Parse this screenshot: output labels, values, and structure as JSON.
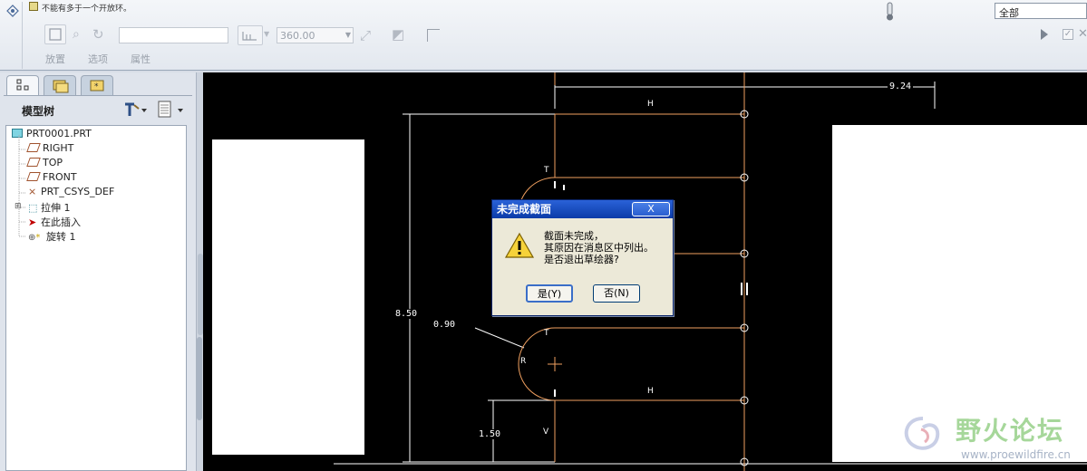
{
  "toolbar": {
    "message": "不能有多于一个开放环。",
    "angle_value": "360.00",
    "tabs": [
      "放置",
      "选项",
      "属性"
    ],
    "filter_value": "全部"
  },
  "model_tree": {
    "title": "模型树",
    "items": [
      {
        "label": "PRT0001.PRT"
      },
      {
        "label": "RIGHT"
      },
      {
        "label": "TOP"
      },
      {
        "label": "FRONT"
      },
      {
        "label": "PRT_CSYS_DEF"
      },
      {
        "label": "拉伸 1"
      },
      {
        "label": "在此插入"
      },
      {
        "label": "旋转 1"
      }
    ]
  },
  "sketch": {
    "dim_top": "9.24",
    "dim_height": "8.50",
    "dim_radius": "0.90",
    "dim_bottom": "1.50",
    "h1": "H",
    "h2": "H",
    "v1": "V",
    "r1": "R",
    "t1": "T",
    "t2": "T"
  },
  "dialog": {
    "title": "未完成截面",
    "line1": "截面未完成，",
    "line2": "其原因在消息区中列出。",
    "line3": "是否退出草绘器?",
    "yes_label": "是(Y)",
    "no_label": "否(N)",
    "close_label": "X"
  },
  "watermark": {
    "brand": "野火论坛",
    "url": "www.proewildfire.cn"
  }
}
